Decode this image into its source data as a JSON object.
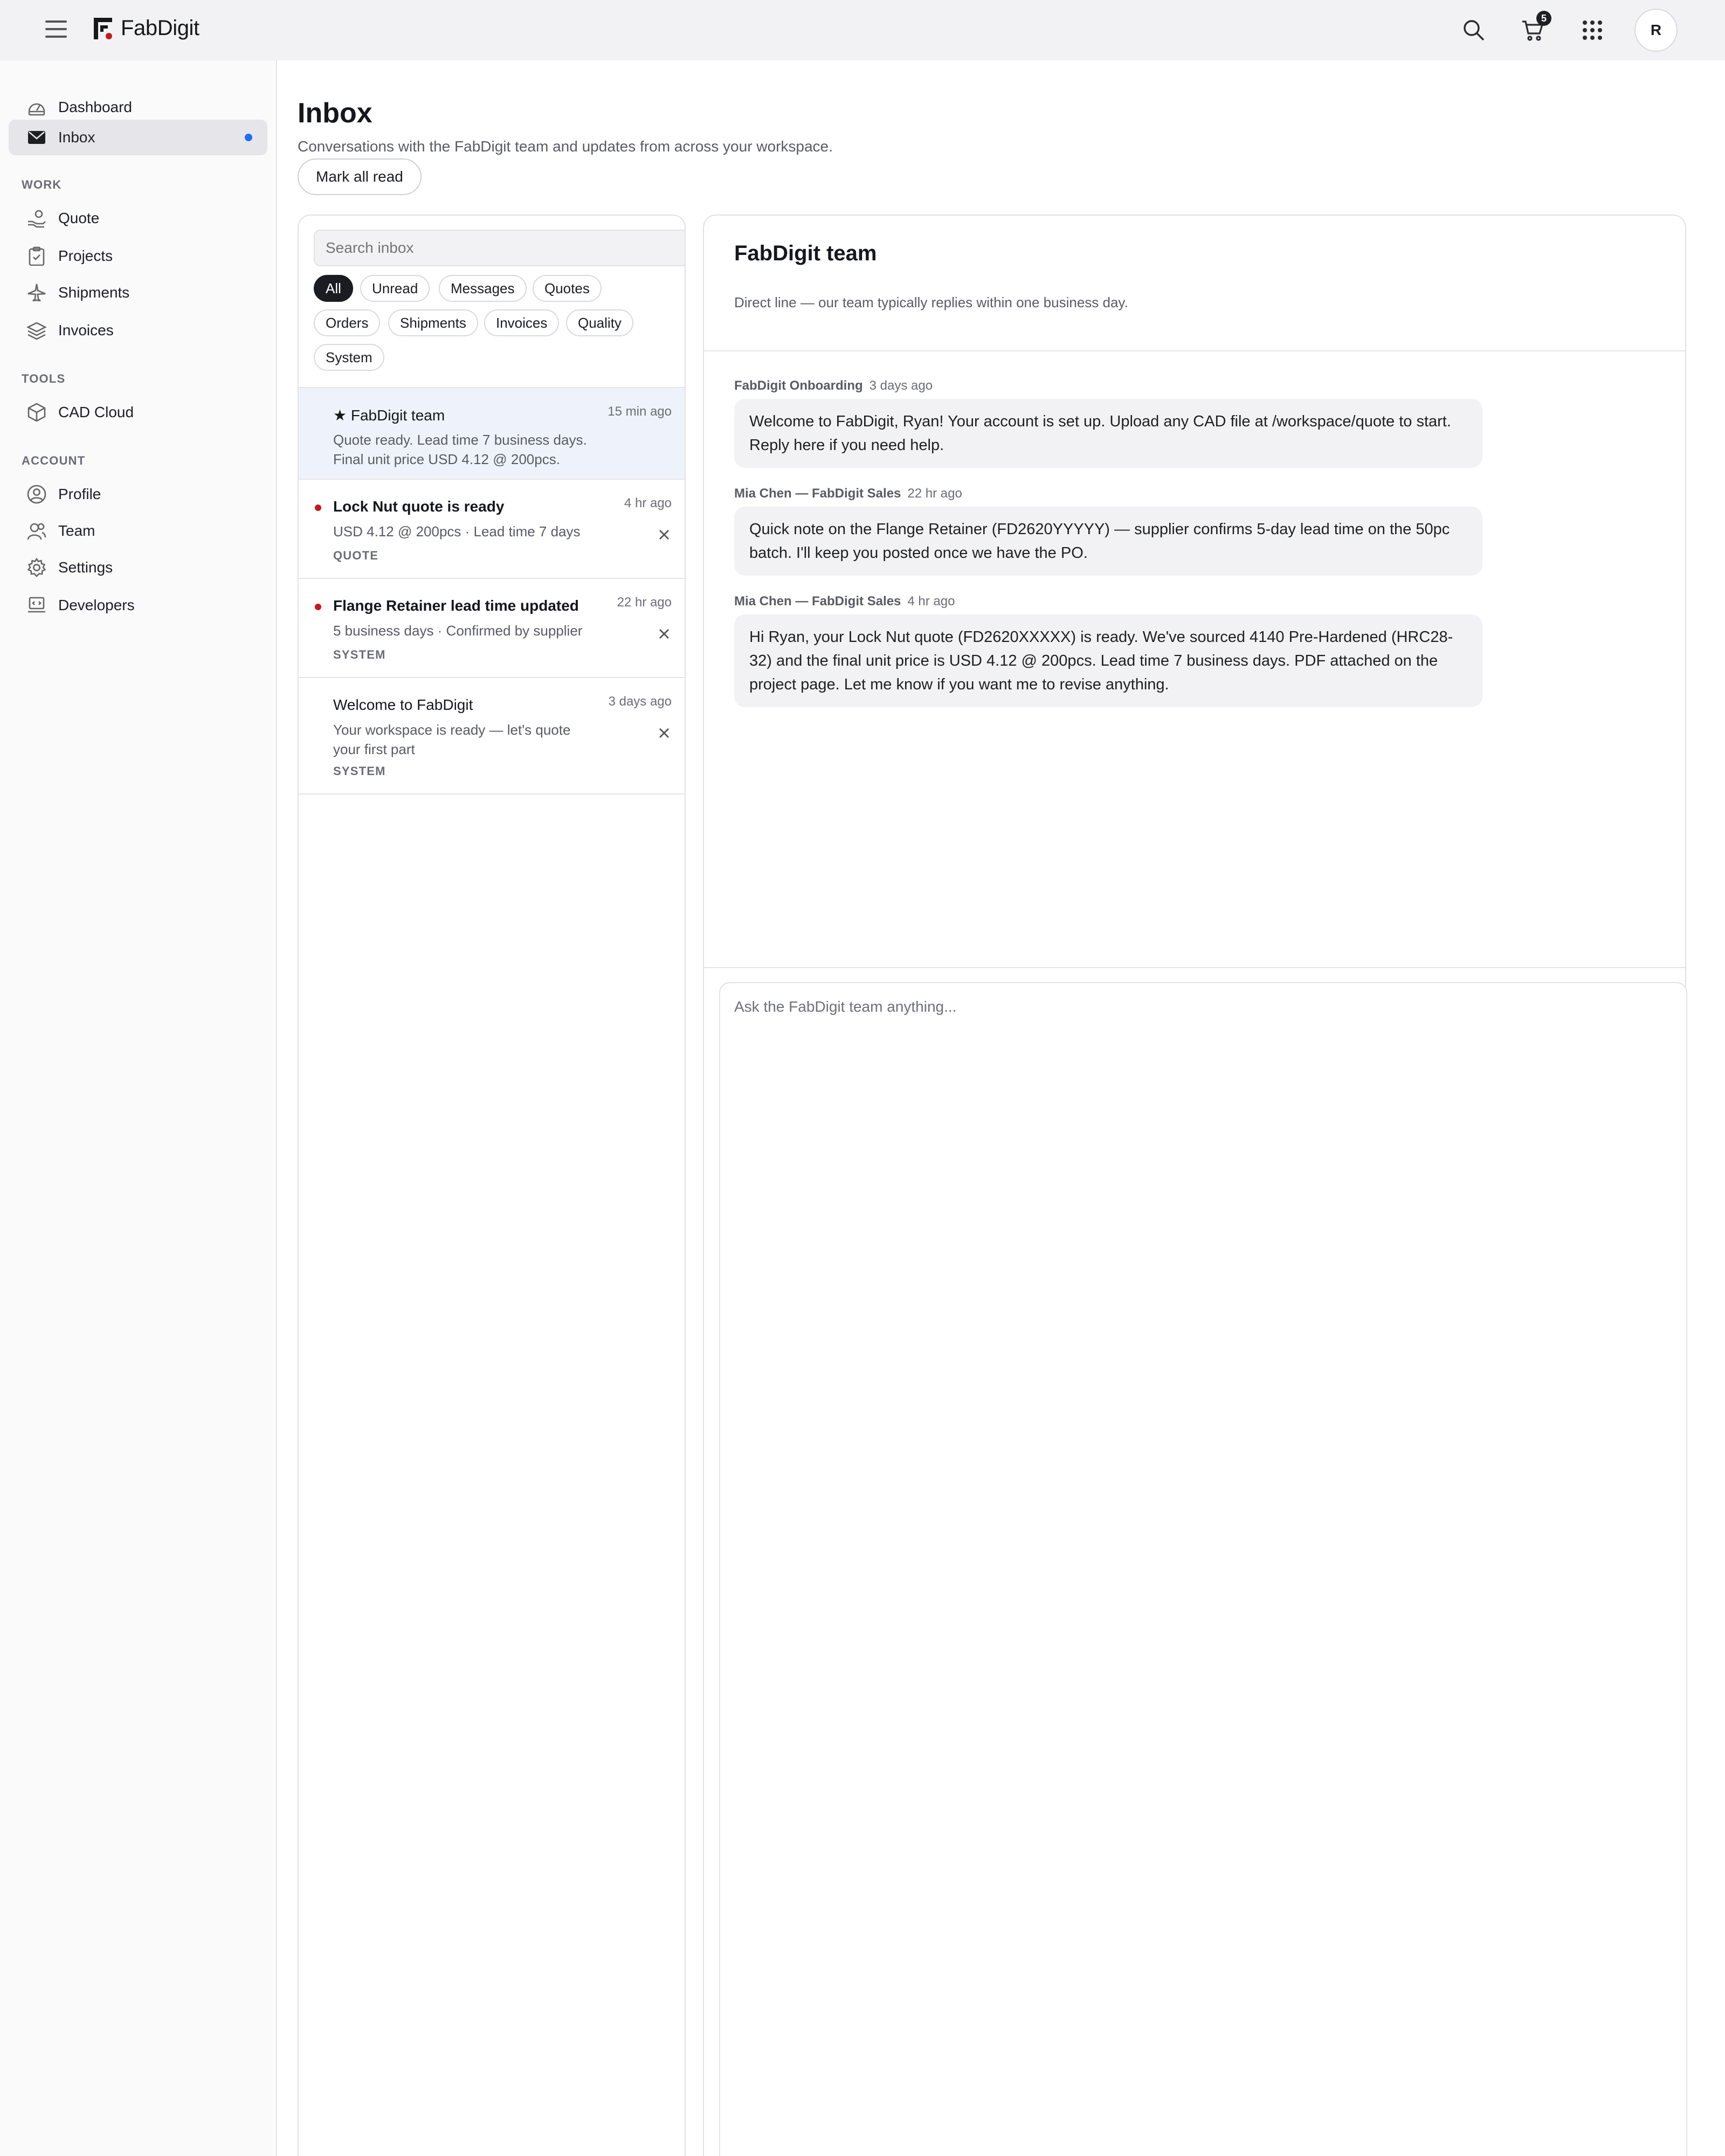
{
  "app": {
    "brand": "FabDigit",
    "cart_count": "5",
    "avatar_initial": "R",
    "accent": "#c51a1a",
    "unread_blue": "#1d6ff2"
  },
  "icons": {
    "menu": "hamburger-menu-icon",
    "search": "search-icon",
    "cart": "cart-icon",
    "apps": "grid-apps-icon"
  },
  "sidebar": {
    "top_items": [
      {
        "label": "Dashboard",
        "icon": "dashboard-gauge-icon"
      },
      {
        "label": "Inbox",
        "icon": "envelope-icon",
        "active": true
      }
    ],
    "sections": [
      {
        "label": "WORK",
        "items": [
          {
            "label": "Quote",
            "icon": "hand-coin-icon"
          },
          {
            "label": "Projects",
            "icon": "clipboard-icon"
          },
          {
            "label": "Shipments",
            "icon": "plane-icon"
          },
          {
            "label": "Invoices",
            "icon": "layers-icon"
          }
        ]
      },
      {
        "label": "TOOLS",
        "items": [
          {
            "label": "CAD Cloud",
            "icon": "cube-icon"
          }
        ]
      },
      {
        "label": "ACCOUNT",
        "items": [
          {
            "label": "Profile",
            "icon": "user-circle-icon"
          },
          {
            "label": "Team",
            "icon": "users-icon"
          },
          {
            "label": "Settings",
            "icon": "gear-icon"
          },
          {
            "label": "Developers",
            "icon": "code-laptop-icon"
          }
        ]
      }
    ]
  },
  "page": {
    "title": "Inbox",
    "subtitle": "Conversations with the FabDigit team and updates from across your workspace.",
    "mark_all_read": "Mark all read"
  },
  "inbox": {
    "search_placeholder": "Search inbox",
    "filters": [
      "All",
      "Unread",
      "Messages",
      "Quotes",
      "Orders",
      "Shipments",
      "Invoices",
      "Quality",
      "System"
    ],
    "active_filter": "All",
    "conversations": [
      {
        "title": "★ FabDigit team",
        "time": "15 min ago",
        "body": "Quote ready. Lead time 7 business days. Final unit price USD 4.12 @ 200pcs.",
        "tag": "",
        "unread": false,
        "selected": true
      },
      {
        "title": "Lock Nut quote is ready",
        "time": "4 hr ago",
        "body": "USD 4.12 @ 200pcs · Lead time 7 days",
        "tag": "QUOTE",
        "unread": true,
        "selected": false
      },
      {
        "title": "Flange Retainer lead time updated",
        "time": "22 hr ago",
        "body": "5 business days · Confirmed by supplier",
        "tag": "SYSTEM",
        "unread": true,
        "selected": false
      },
      {
        "title": "Welcome to FabDigit",
        "time": "3 days ago",
        "body": "Your workspace is ready — let's quote your first part",
        "tag": "SYSTEM",
        "unread": false,
        "selected": false
      }
    ]
  },
  "thread": {
    "title": "FabDigit team",
    "subtitle": "Direct line — our team typically replies within one business day.",
    "messages": [
      {
        "sender": "FabDigit Onboarding",
        "time": "3 days ago",
        "text": "Welcome to FabDigit, Ryan! Your account is set up. Upload any CAD file at /workspace/quote to start. Reply here if you need help."
      },
      {
        "sender": "Mia Chen — FabDigit Sales",
        "time": "22 hr ago",
        "text": "Quick note on the Flange Retainer (FD2620YYYYY) — supplier confirms 5-day lead time on the 50pc batch. I'll keep you posted once we have the PO."
      },
      {
        "sender": "Mia Chen — FabDigit Sales",
        "time": "4 hr ago",
        "text": "Hi Ryan, your Lock Nut quote (FD2620XXXXX) is ready. We've sourced 4140 Pre-Hardened (HRC28-32) and the final unit price is USD 4.12 @ 200pcs. Lead time 7 business days. PDF attached on the project page. Let me know if you want me to revise anything."
      }
    ],
    "composer_placeholder": "Ask the FabDigit team anything..."
  }
}
